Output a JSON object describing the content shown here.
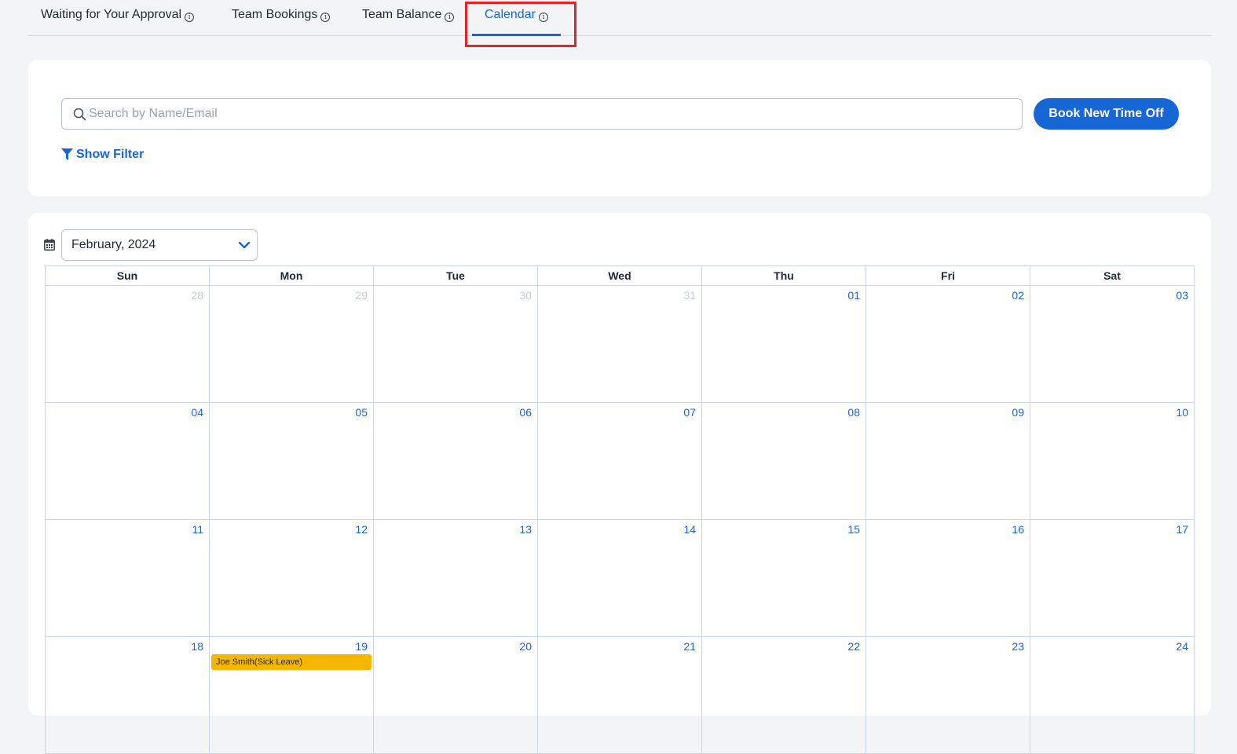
{
  "tabs": [
    {
      "label": "Waiting for Your Approval",
      "active": false
    },
    {
      "label": "Team Bookings",
      "active": false
    },
    {
      "label": "Team Balance",
      "active": false
    },
    {
      "label": "Calendar",
      "active": true
    }
  ],
  "info_glyph": "i",
  "search": {
    "placeholder": "Search by Name/Email",
    "value": "",
    "icon": "search-icon"
  },
  "book_button": {
    "label": "Book New Time Off"
  },
  "filter": {
    "label": "Show Filter",
    "icon": "filter-icon"
  },
  "calendar": {
    "month_label": "February, 2024",
    "weekdays": [
      "Sun",
      "Mon",
      "Tue",
      "Wed",
      "Thu",
      "Fri",
      "Sat"
    ],
    "weeks": [
      [
        {
          "d": "28",
          "other": true
        },
        {
          "d": "29",
          "other": true
        },
        {
          "d": "30",
          "other": true
        },
        {
          "d": "31",
          "other": true
        },
        {
          "d": "01"
        },
        {
          "d": "02"
        },
        {
          "d": "03"
        }
      ],
      [
        {
          "d": "04"
        },
        {
          "d": "05"
        },
        {
          "d": "06"
        },
        {
          "d": "07"
        },
        {
          "d": "08"
        },
        {
          "d": "09"
        },
        {
          "d": "10"
        }
      ],
      [
        {
          "d": "11"
        },
        {
          "d": "12"
        },
        {
          "d": "13"
        },
        {
          "d": "14"
        },
        {
          "d": "15"
        },
        {
          "d": "16"
        },
        {
          "d": "17"
        }
      ],
      [
        {
          "d": "18"
        },
        {
          "d": "19",
          "events": [
            "Joe Smith(Sick Leave)"
          ]
        },
        {
          "d": "20"
        },
        {
          "d": "21"
        },
        {
          "d": "22"
        },
        {
          "d": "23"
        },
        {
          "d": "24"
        }
      ]
    ]
  },
  "colors": {
    "accent": "#1766d6",
    "event_bg": "#f5b600",
    "highlight_border": "#e0262b"
  }
}
